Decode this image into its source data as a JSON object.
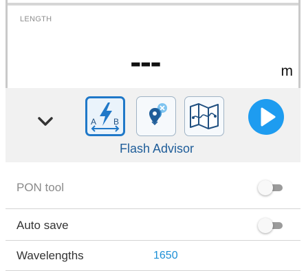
{
  "measurement": {
    "label": "LENGTH",
    "value": "---",
    "unit": "m"
  },
  "toolbar": {
    "collapse_icon": "chevron-down-icon",
    "tools": [
      {
        "icon": "flash-advisor-icon",
        "selected": true
      },
      {
        "icon": "pins-icon",
        "selected": false
      },
      {
        "icon": "map-icon",
        "selected": false
      }
    ],
    "selected_tool_caption": "Flash Advisor",
    "run_icon": "play-icon",
    "accent_color": "#1e9cf0",
    "selected_border_color": "#1f78c8"
  },
  "settings": {
    "pon_tool": {
      "label": "PON tool",
      "enabled": false
    },
    "auto_save": {
      "label": "Auto save",
      "enabled": false
    },
    "wavelengths": {
      "label": "Wavelengths",
      "value": "1650"
    }
  }
}
